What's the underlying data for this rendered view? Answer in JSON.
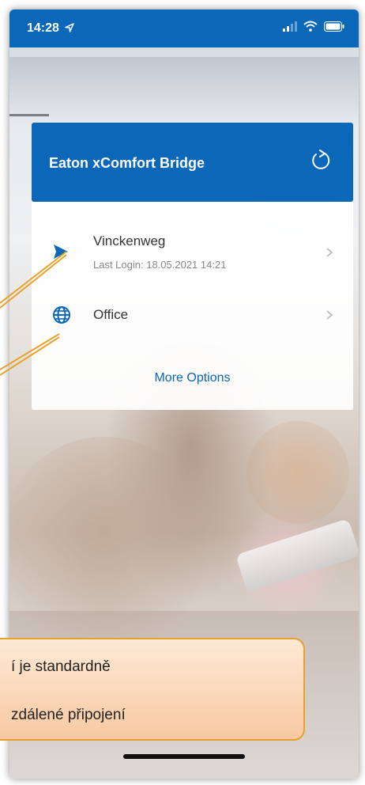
{
  "status_bar": {
    "time": "14:28",
    "location_icon": "location-arrow-icon",
    "icons": [
      "cellular-signal-icon",
      "wifi-icon",
      "battery-icon"
    ]
  },
  "header": {
    "title": "Eaton xComfort Bridge",
    "refresh_icon": "refresh-icon"
  },
  "connections": [
    {
      "name": "Vinckenweg",
      "subtitle": "Last Login: 18.05.2021 14:21",
      "icon": "play-arrow-icon"
    },
    {
      "name": "Office",
      "icon": "globe-icon"
    }
  ],
  "more_options": "More Options",
  "callout": {
    "line1": "í je standardně",
    "line2": "zdálené připojení"
  },
  "colors": {
    "accent": "#0b67b8",
    "callout_border": "#e8a12c",
    "callout_fill": "#fbd9b9",
    "annotation_arrow": "#e8a12c"
  }
}
